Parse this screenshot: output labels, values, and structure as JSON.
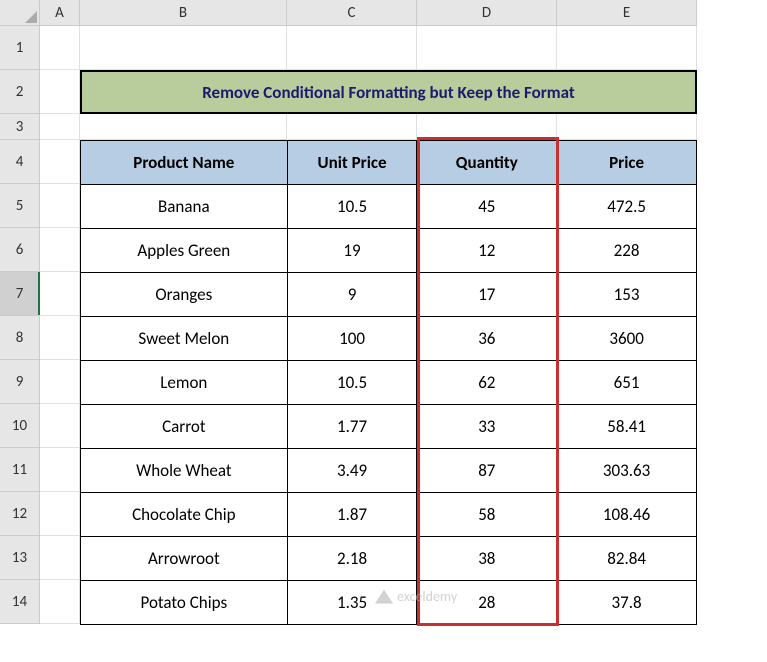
{
  "columns": [
    "A",
    "B",
    "C",
    "D",
    "E"
  ],
  "rows": [
    "1",
    "2",
    "3",
    "4",
    "5",
    "6",
    "7",
    "8",
    "9",
    "10",
    "11",
    "12",
    "13",
    "14"
  ],
  "selected_row": "7",
  "title": "Remove Conditional Formatting but Keep the Format",
  "headers": {
    "product_name": "Product Name",
    "unit_price": "Unit Price",
    "quantity": "Quantity",
    "price": "Price"
  },
  "chart_data": {
    "type": "table",
    "columns": [
      "Product Name",
      "Unit Price",
      "Quantity",
      "Price"
    ],
    "rows": [
      {
        "product": "Banana",
        "unit_price": "10.5",
        "quantity": "45",
        "price": "472.5"
      },
      {
        "product": "Apples Green",
        "unit_price": "19",
        "quantity": "12",
        "price": "228"
      },
      {
        "product": "Oranges",
        "unit_price": "9",
        "quantity": "17",
        "price": "153"
      },
      {
        "product": "Sweet Melon",
        "unit_price": "100",
        "quantity": "36",
        "price": "3600"
      },
      {
        "product": "Lemon",
        "unit_price": "10.5",
        "quantity": "62",
        "price": "651"
      },
      {
        "product": "Carrot",
        "unit_price": "1.77",
        "quantity": "33",
        "price": "58.41"
      },
      {
        "product": "Whole Wheat",
        "unit_price": "3.49",
        "quantity": "87",
        "price": "303.63"
      },
      {
        "product": "Chocolate Chip",
        "unit_price": "1.87",
        "quantity": "58",
        "price": "108.46"
      },
      {
        "product": "Arrowroot",
        "unit_price": "2.18",
        "quantity": "38",
        "price": "82.84"
      },
      {
        "product": "Potato Chips",
        "unit_price": "1.35",
        "quantity": "28",
        "price": "37.8"
      }
    ]
  },
  "watermark": "exceldemy",
  "colors": {
    "header_bg": "#b7cde4",
    "title_bg": "#b8cc9c",
    "title_color": "#1b1b6f",
    "highlight_border": "#c82f2f"
  }
}
